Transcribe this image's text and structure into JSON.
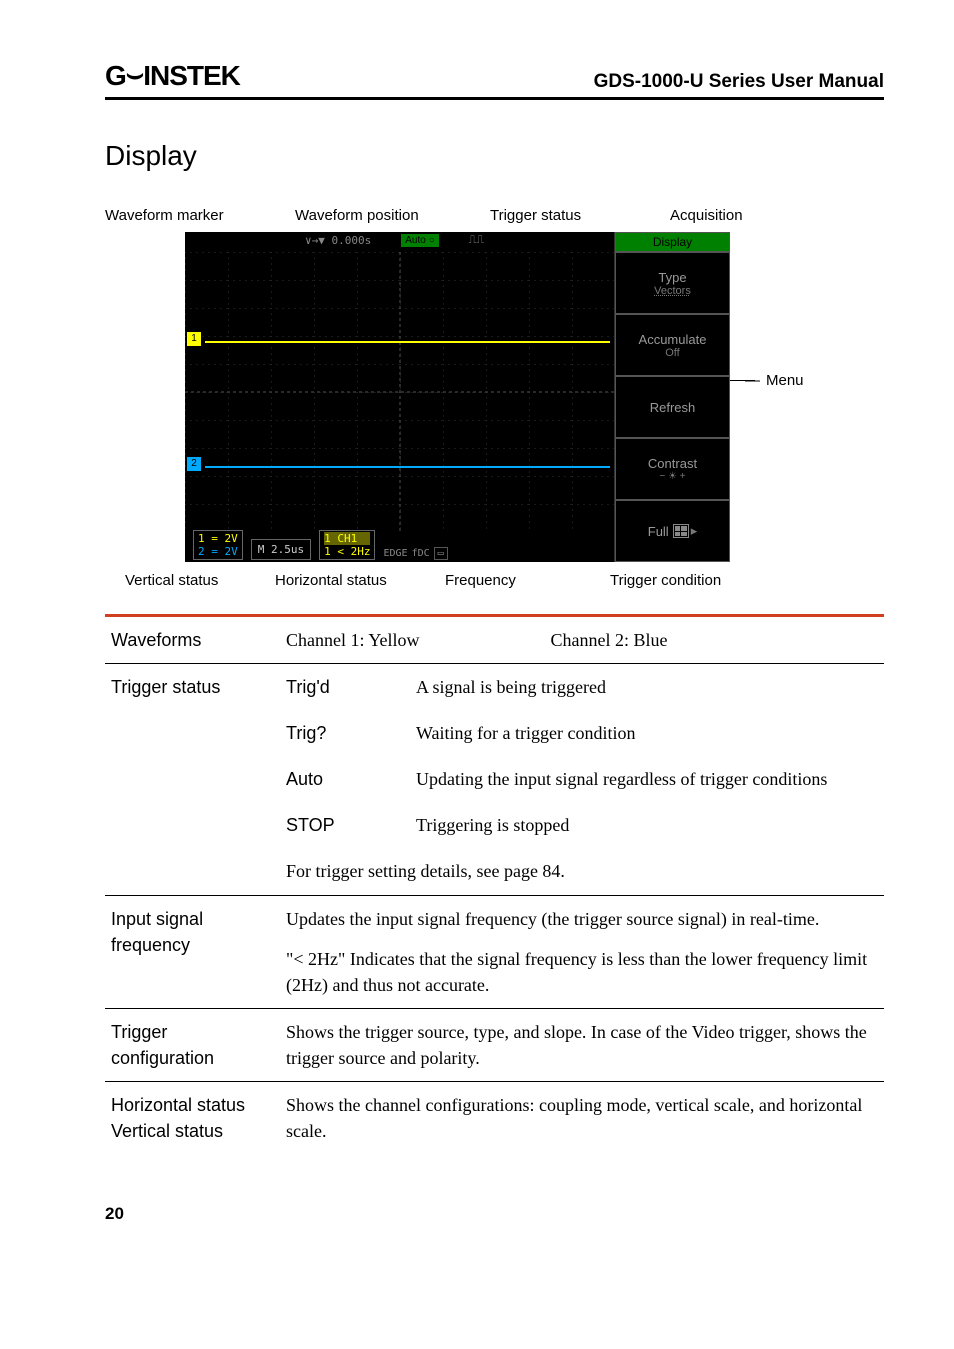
{
  "header": {
    "logo": "GWINSTEK",
    "title": "GDS-1000-U Series User Manual"
  },
  "section_title": "Display",
  "diagram": {
    "top_labels": {
      "waveform_marker": "Waveform marker",
      "waveform_position": "Waveform position",
      "trigger_status": "Trigger status",
      "acquisition": "Acquisition"
    },
    "bottom_labels": {
      "vertical_status": "Vertical status",
      "horizontal_status": "Horizontal status",
      "frequency": "Frequency",
      "trigger_condition": "Trigger condition"
    },
    "menu_callout": "Menu",
    "scope": {
      "waveform_position_readout": "0.000s",
      "trigger_status_badge": "Auto",
      "menu_title": "Display",
      "menu_items": [
        {
          "label": "Type",
          "sub": "Vectors"
        },
        {
          "label": "Accumulate",
          "sub": "Off"
        },
        {
          "label": "Refresh",
          "sub": ""
        },
        {
          "label": "Contrast",
          "sub": ""
        },
        {
          "label": "Full",
          "sub": ""
        }
      ],
      "vertical_status": {
        "ch1": "1 = 2V",
        "ch2": "2 = 2V"
      },
      "horizontal_status": "M 2.5us",
      "frequency": {
        "ch": "1 CH1",
        "hz": "1 < 2Hz"
      },
      "trigger_condition": {
        "mode": "EDGE",
        "slope": "fDC"
      },
      "markers": {
        "ch1": "1",
        "ch2": "2"
      }
    }
  },
  "table": {
    "waveforms": {
      "label": "Waveforms",
      "ch1": "Channel 1: Yellow",
      "ch2": "Channel 2: Blue"
    },
    "trigger_status": {
      "label": "Trigger status",
      "rows": [
        {
          "name": "Trig'd",
          "desc": "A signal is being triggered"
        },
        {
          "name": "Trig?",
          "desc": "Waiting for a trigger condition"
        },
        {
          "name": "Auto",
          "desc": "Updating the input signal regardless of trigger conditions"
        },
        {
          "name": "STOP",
          "desc": "Triggering is stopped"
        }
      ],
      "footer": "For trigger setting details, see page 84."
    },
    "input_signal_frequency": {
      "label": "Input signal frequency",
      "p1": "Updates the input signal frequency (the trigger source signal) in real-time.",
      "p2": "\"< 2Hz\" Indicates that the signal frequency is less than the lower frequency limit (2Hz) and thus not accurate."
    },
    "trigger_configuration": {
      "label": "Trigger configuration",
      "desc": "Shows the trigger source, type, and slope. In case of the Video trigger, shows the trigger source and polarity."
    },
    "hv_status": {
      "label1": "Horizontal status",
      "label2": "Vertical status",
      "desc": "Shows the channel configurations: coupling mode, vertical scale, and horizontal scale."
    }
  },
  "page_number": "20"
}
